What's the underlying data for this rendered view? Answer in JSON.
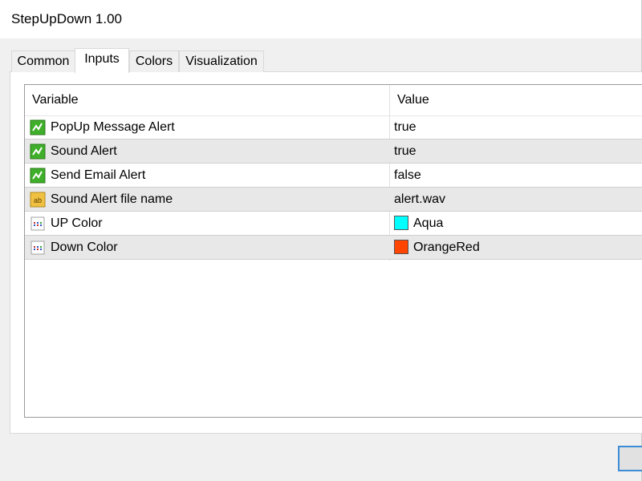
{
  "window": {
    "title": "StepUpDown 1.00"
  },
  "tabs": [
    {
      "label": "Common",
      "active": false
    },
    {
      "label": "Inputs",
      "active": true
    },
    {
      "label": "Colors",
      "active": false
    },
    {
      "label": "Visualization",
      "active": false
    }
  ],
  "grid": {
    "columns": {
      "variable": "Variable",
      "value": "Value"
    },
    "rows": [
      {
        "icon": "bool-param-icon",
        "variable": "PopUp Message Alert",
        "value": "true"
      },
      {
        "icon": "bool-param-icon",
        "variable": "Sound Alert",
        "value": "true"
      },
      {
        "icon": "bool-param-icon",
        "variable": "Send Email Alert",
        "value": "false"
      },
      {
        "icon": "string-param-icon",
        "variable": "Sound Alert file name",
        "value": "alert.wav"
      },
      {
        "icon": "color-param-icon",
        "variable": "UP Color",
        "value": "Aqua",
        "color": "#00ffff"
      },
      {
        "icon": "color-param-icon",
        "variable": "Down Color",
        "value": "OrangeRed",
        "color": "#ff4500"
      }
    ]
  },
  "colors": {
    "bool_icon": "#3fae2a",
    "string_icon": "#f0c040",
    "focus_border": "#3c8cd6"
  }
}
